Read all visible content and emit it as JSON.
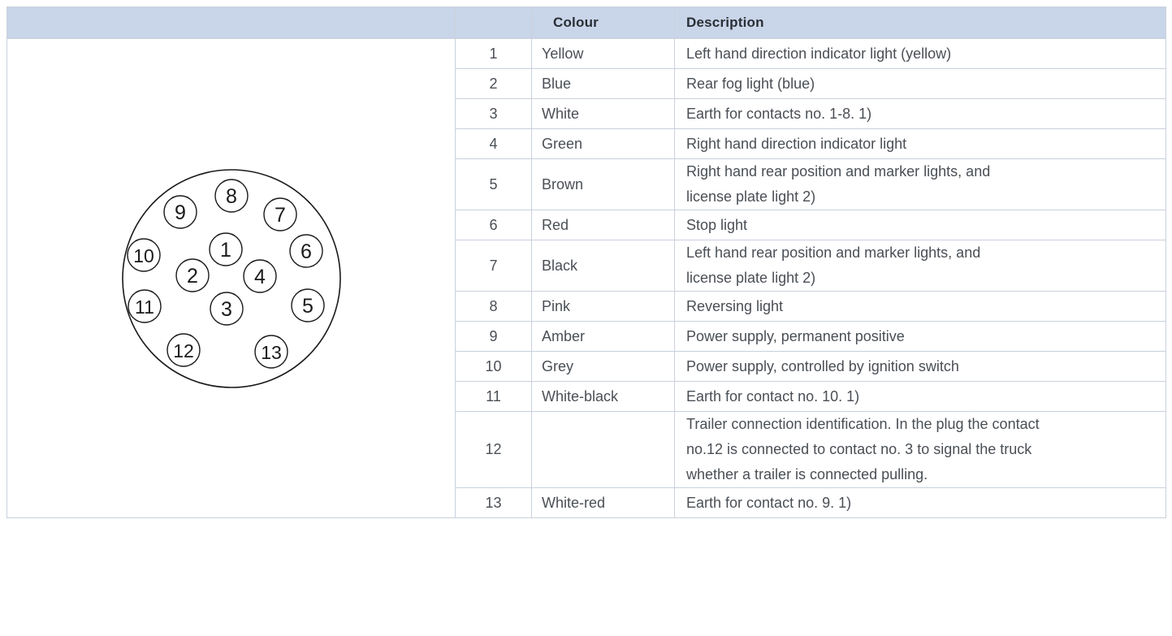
{
  "table": {
    "headers": {
      "number": "",
      "colour": "Colour",
      "description": "Description"
    },
    "rows": [
      {
        "number": "1",
        "colour": "Yellow",
        "description_lines": [
          "Left hand direction indicator light (yellow)"
        ]
      },
      {
        "number": "2",
        "colour": "Blue",
        "description_lines": [
          "Rear fog light (blue)"
        ]
      },
      {
        "number": "3",
        "colour": "White",
        "description_lines": [
          "Earth for contacts no. 1-8. 1)"
        ]
      },
      {
        "number": "4",
        "colour": "Green",
        "description_lines": [
          "Right hand direction indicator light"
        ]
      },
      {
        "number": "5",
        "colour": "Brown",
        "description_lines": [
          "Right hand rear position and marker lights, and",
          "license plate light 2)"
        ]
      },
      {
        "number": "6",
        "colour": "Red",
        "description_lines": [
          "Stop light"
        ]
      },
      {
        "number": "7",
        "colour": "Black",
        "description_lines": [
          "Left hand rear position and marker lights, and",
          "license plate light 2)"
        ]
      },
      {
        "number": "8",
        "colour": "Pink",
        "description_lines": [
          "Reversing light"
        ]
      },
      {
        "number": "9",
        "colour": "Amber",
        "description_lines": [
          "Power supply, permanent positive"
        ]
      },
      {
        "number": "10",
        "colour": "Grey",
        "description_lines": [
          "Power supply, controlled by ignition switch"
        ]
      },
      {
        "number": "11",
        "colour": "White-black",
        "description_lines": [
          "Earth for contact no. 10. 1)"
        ]
      },
      {
        "number": "12",
        "colour": "",
        "description_lines": [
          "Trailer connection identification. In the plug the contact",
          "no.12 is connected to contact no. 3 to signal the truck",
          "whether a trailer is connected pulling."
        ]
      },
      {
        "number": "13",
        "colour": "White-red",
        "description_lines": [
          "Earth for contact no. 9. 1)"
        ]
      }
    ]
  },
  "diagram": {
    "pin_labels": [
      "8",
      "9",
      "7",
      "10",
      "1",
      "6",
      "2",
      "4",
      "11",
      "3",
      "5",
      "12",
      "13"
    ]
  },
  "colors": {
    "header_bg": "#c9d5e8",
    "border": "#c9d1dc",
    "text": "#4a4f55"
  }
}
